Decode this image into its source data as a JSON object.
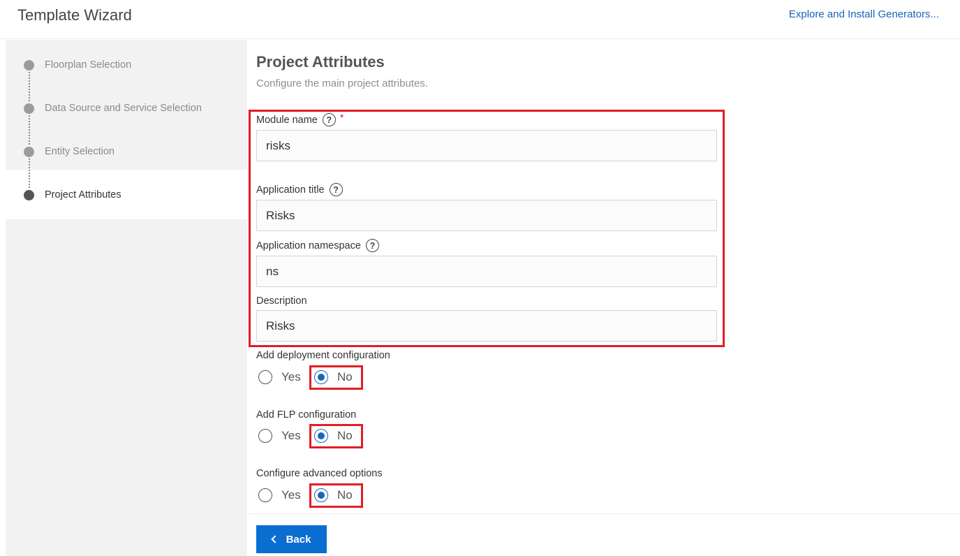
{
  "header": {
    "title": "Template Wizard",
    "explore_link": "Explore and Install Generators..."
  },
  "steps": [
    {
      "label": "Floorplan Selection",
      "state": "completed"
    },
    {
      "label": "Data Source and Service Selection",
      "state": "completed"
    },
    {
      "label": "Entity Selection",
      "state": "completed"
    },
    {
      "label": "Project Attributes",
      "state": "current"
    }
  ],
  "main": {
    "title": "Project Attributes",
    "subtitle": "Configure the main project attributes."
  },
  "form": {
    "module_name": {
      "label": "Module name",
      "value": "risks",
      "required_mark": "*"
    },
    "application_title": {
      "label": "Application title",
      "value": "Risks"
    },
    "application_namespace": {
      "label": "Application namespace",
      "value": "ns"
    },
    "description": {
      "label": "Description",
      "value": "Risks"
    },
    "help_glyph": "?"
  },
  "options": {
    "deployment": {
      "label": "Add deployment configuration",
      "yes": "Yes",
      "no": "No",
      "selected": "No"
    },
    "flp": {
      "label": "Add FLP configuration",
      "yes": "Yes",
      "no": "No",
      "selected": "No"
    },
    "advanced": {
      "label": "Configure advanced options",
      "yes": "Yes",
      "no": "No",
      "selected": "No"
    }
  },
  "footer": {
    "back_label": "Back"
  },
  "colors": {
    "accent": "#0a6ed1",
    "highlight": "#e01e26",
    "link": "#1a64b8"
  }
}
